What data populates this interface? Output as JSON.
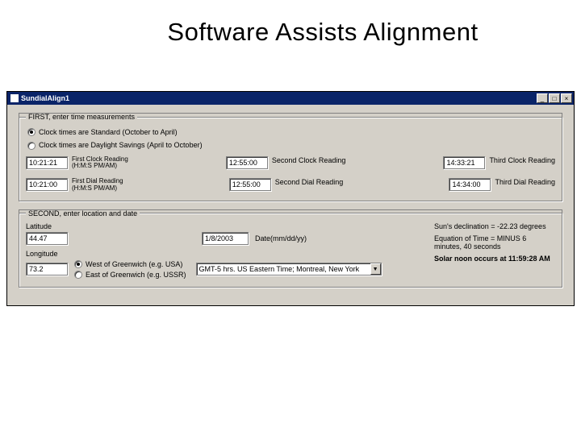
{
  "slide": {
    "title": "Software Assists Alignment"
  },
  "window": {
    "title": "SundialAlign1",
    "min": "_",
    "max": "□",
    "close": "×"
  },
  "first": {
    "legend": "FIRST, enter time measurements",
    "radio_std": "Clock times are Standard (October to April)",
    "radio_dst": "Clock times are Daylight Savings (April to October)",
    "clock1_val": "10:21:21",
    "clock1_lbl1": "First Clock Reading",
    "clock1_lbl2": "(H:M:S PM/AM)",
    "clock2_val": "12:55:00",
    "clock2_lbl": "Second Clock Reading",
    "clock3_val": "14:33:21",
    "clock3_lbl": "Third Clock Reading",
    "dial1_val": "10:21:00",
    "dial1_lbl1": "First Dial Reading",
    "dial1_lbl2": "(H:M:S PM/AM)",
    "dial2_val": "12:55:00",
    "dial2_lbl": "Second Dial Reading",
    "dial3_val": "14:34:00",
    "dial3_lbl": "Third Dial Reading"
  },
  "second": {
    "legend": "SECOND, enter location and date",
    "lat_lbl": "Latitude",
    "lat_val": "44.47",
    "date_val": "1/8/2003",
    "date_lbl": "Date(mm/dd/yy)",
    "lon_lbl": "Longitude",
    "lon_val": "73.2",
    "radio_west": "West of Greenwich (e.g. USA)",
    "radio_east": "East of Greenwich (e.g. USSR)",
    "tz_val": "GMT-5 hrs. US Eastern Time; Montreal, New York",
    "decl_lbl": "Sun's declination = -22.23 degrees",
    "eot_lbl": "Equation of Time = MINUS 6 minutes, 40 seconds",
    "noon_lbl": "Solar noon occurs at 11:59:28 AM"
  }
}
